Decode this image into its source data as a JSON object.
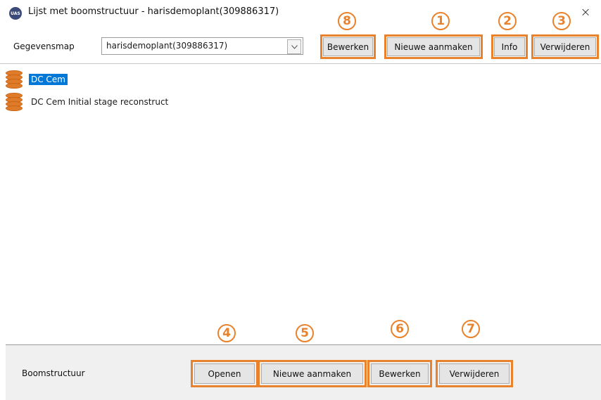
{
  "window": {
    "logo_text": "UAS",
    "title": "Lijst met boomstructuur  - harisdemoplant(309886317)",
    "close_glyph": "×"
  },
  "toolbar": {
    "folder_label": "Gegevensmap",
    "folder_value": "harisdemoplant(309886317)",
    "edit_label": "Bewerken",
    "new_label": "Nieuwe aanmaken",
    "info_label": "Info",
    "delete_label": "Verwijderen"
  },
  "tree": {
    "items": [
      {
        "label": "DC Cem",
        "selected": true
      },
      {
        "label": "DC Cem Initial stage reconstruct",
        "selected": false
      }
    ]
  },
  "footer": {
    "tree_label": "Boomstructuur",
    "open_label": "Openen",
    "new_label": "Nieuwe aanmaken",
    "edit_label": "Bewerken",
    "delete_label": "Verwijderen"
  },
  "markers": {
    "m1": "1",
    "m2": "2",
    "m3": "3",
    "m4": "4",
    "m5": "5",
    "m6": "6",
    "m7": "7",
    "m8": "8"
  },
  "colors": {
    "highlight": "#e8822c",
    "selection": "#0078d7",
    "db_icon": "#e07b2a"
  },
  "icons": {
    "app": "app-logo-icon",
    "close": "close-icon",
    "dropdown": "chevron-down-icon",
    "tree_item": "database-icon"
  }
}
